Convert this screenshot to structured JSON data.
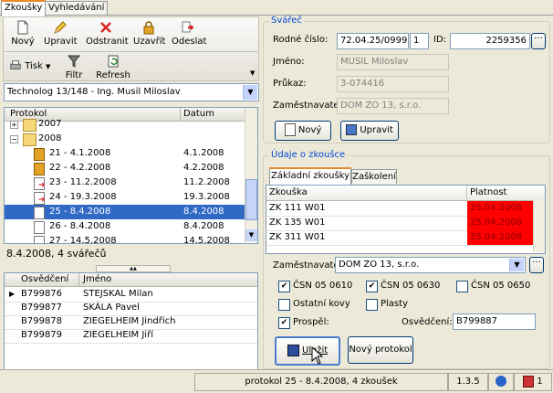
{
  "tabs": [
    {
      "label": "Zkoušky"
    },
    {
      "label": "Vyhledávání"
    }
  ],
  "toolbar": {
    "new": "Nový",
    "edit": "Upravit",
    "remove": "Odstranit",
    "lock": "Uzavřít",
    "send": "Odeslat",
    "print": "Tisk",
    "filter": "Filtr",
    "refresh": "Refresh"
  },
  "technolog_select": "Technolog 13/148 - Ing. Musil Miloslav",
  "tree": {
    "header_protocol": "Protokol",
    "header_date": "Datum",
    "rows": [
      {
        "label": "2007",
        "date": ""
      },
      {
        "label": "2008",
        "date": ""
      },
      {
        "label": "21 - 4.1.2008",
        "date": "4.1.2008"
      },
      {
        "label": "22 - 4.2.2008",
        "date": "4.2.2008"
      },
      {
        "label": "23 - 11.2.2008",
        "date": "11.2.2008"
      },
      {
        "label": "24 - 19.3.2008",
        "date": "19.3.2008"
      },
      {
        "label": "25 - 8.4.2008",
        "date": "8.4.2008"
      },
      {
        "label": "26 - 8.4.2008",
        "date": "8.4.2008"
      },
      {
        "label": "27 - 14.5.2008",
        "date": "14.5.2008"
      }
    ]
  },
  "welders_summary": "8.4.2008, 4 svářečů",
  "welders": {
    "col_cert": "Osvědčení",
    "col_name": "Jméno",
    "rows": [
      {
        "cert": "B799876",
        "name": "STEJSKAL Milan"
      },
      {
        "cert": "B799877",
        "name": "SKÁLA Pavel"
      },
      {
        "cert": "B799878",
        "name": "ZIEGELHEIM Jindřich"
      },
      {
        "cert": "B799879",
        "name": "ZIEGELHEIM Jiří"
      }
    ]
  },
  "svarec": {
    "title": "Svářeč",
    "birth_label": "Rodné číslo:",
    "birth_value": "72.04.25/0999",
    "birth_suffix": "1",
    "id_label": "ID:",
    "id_value": "2259356",
    "name_label": "Jméno:",
    "name_value": "MUSIL Miloslav",
    "card_label": "Průkaz:",
    "card_value": "3-074416",
    "employer_label": "Zaměstnavatel:",
    "employer_value": "DOM ZO 13, s.r.o.",
    "new_btn": "Nový",
    "edit_btn": "Upravit"
  },
  "exam": {
    "title": "Údaje o zkoušce",
    "tab_basic": "Základní zkoušky",
    "tab_training": "Zaškolení",
    "col_exam": "Zkouška",
    "col_valid": "Platnost",
    "rows": [
      {
        "exam": "ZK 111 W01",
        "valid": "25.04.2008"
      },
      {
        "exam": "ZK 135 W01",
        "valid": "25.04.2008"
      },
      {
        "exam": "ZK 311 W01",
        "valid": "25.04.2008"
      }
    ],
    "employer_label": "Zaměstnavatel:",
    "employer_value": "DOM ZO 13, s.r.o.",
    "chk_0610": "ČSN 05 0610",
    "chk_0630": "ČSN 05 0630",
    "chk_0650": "ČSN 05 0650",
    "chk_other": "Ostatní kovy",
    "chk_plastic": "Plasty",
    "chk_passed": "Prospěl:",
    "cert_label": "Osvědčení:",
    "cert_value": "B799887",
    "save_btn": "Uložit",
    "new_protocol_btn": "Nový protokol"
  },
  "status": {
    "text": "protokol 25 - 8.4.2008, 4 zkoušek",
    "version": "1.3.5",
    "count": "1"
  },
  "colors": {
    "expired": "#ff0000",
    "selection": "#316ac5",
    "accent": "#0046d5"
  }
}
